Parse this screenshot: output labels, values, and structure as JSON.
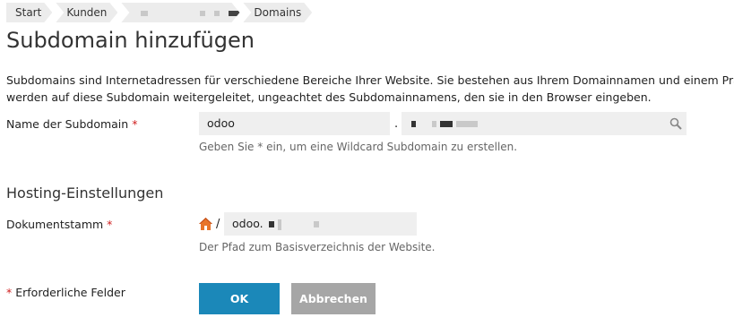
{
  "breadcrumb": {
    "items": [
      {
        "label": "Start"
      },
      {
        "label": "Kunden"
      },
      {
        "label": ""
      },
      {
        "label": "Domains"
      }
    ]
  },
  "page": {
    "title": "Subdomain hinzufügen",
    "description_line1": "Subdomains sind Internetadressen für verschiedene Bereiche Ihrer Website. Sie bestehen aus Ihrem Domainnamen und einem Präfix.",
    "description_line2": "werden auf diese Subdomain weitergeleitet, ungeachtet des Subdomainnamens, den sie in den Browser eingeben."
  },
  "subdomain": {
    "label": "Name der Subdomain",
    "required_mark": "*",
    "value": "odoo",
    "separator": ".",
    "domain_value": "",
    "hint": "Geben Sie * ein, um eine Wildcard Subdomain zu erstellen."
  },
  "hosting": {
    "section_title": "Hosting-Einstellungen",
    "docroot_label": "Dokumentstamm",
    "required_mark": "*",
    "path_prefix": "/",
    "docroot_value": "odoo.",
    "hint": "Der Pfad zum Basisverzeichnis der Website."
  },
  "footer": {
    "required_mark": "*",
    "required_note": "Erforderliche Felder",
    "ok_label": "OK",
    "cancel_label": "Abbrechen"
  },
  "colors": {
    "primary_button": "#1b88b9",
    "secondary_button": "#a6a6a6",
    "required": "#d02020",
    "field_bg": "#efefef"
  },
  "icons": {
    "search": "search-icon",
    "home": "home-icon"
  }
}
